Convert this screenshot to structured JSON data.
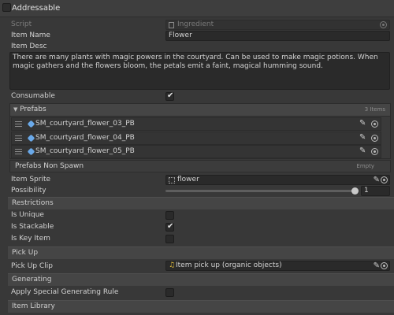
{
  "component": {
    "title": "Addressable"
  },
  "fields": {
    "script": {
      "label": "Script",
      "value": "Ingredient"
    },
    "item_name": {
      "label": "Item Name",
      "value": "Flower"
    },
    "item_desc": {
      "label": "Item Desc",
      "value": "There are many plants with magic powers in the courtyard. Can be used to make magic potions.  When magic gathers and the flowers bloom, the petals emit a faint, magical humming sound."
    },
    "consumable": {
      "label": "Consumable",
      "checked": true
    }
  },
  "prefabs": {
    "label": "Prefabs",
    "count": "3 Items",
    "items": [
      "SM_courtyard_flower_03_PB",
      "SM_courtyard_flower_04_PB",
      "SM_courtyard_flower_05_PB"
    ]
  },
  "prefabs_non_spawn": {
    "label": "Prefabs Non Spawn",
    "status": "Empty"
  },
  "item_sprite": {
    "label": "Item Sprite",
    "value": "flower"
  },
  "possibility": {
    "label": "Possibility",
    "value": "1",
    "fraction": 1.0
  },
  "restrictions": {
    "title": "Restrictions",
    "is_unique": {
      "label": "Is Unique",
      "checked": false
    },
    "is_stackable": {
      "label": "Is Stackable",
      "checked": true
    },
    "is_key_item": {
      "label": "Is Key Item",
      "checked": false
    }
  },
  "pick_up": {
    "title": "Pick Up",
    "clip": {
      "label": "Pick Up Clip",
      "value": "Item pick up (organic objects)"
    }
  },
  "generating": {
    "title": "Generating",
    "apply_rule": {
      "label": "Apply Special Generating Rule",
      "checked": false
    }
  },
  "item_library": {
    "title": "Item Library"
  },
  "colors": {
    "background": "#383838",
    "field": "#2a2a2a",
    "section": "#454545",
    "accent": "#6aa9e9"
  },
  "icons": [
    "checkbox-icon",
    "script-icon",
    "target-icon",
    "handle-icon",
    "prefab-icon",
    "pencil-icon",
    "sprite-icon",
    "audio-icon"
  ]
}
